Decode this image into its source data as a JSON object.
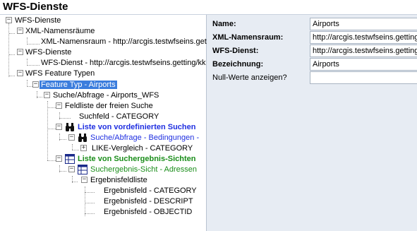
{
  "title": "WFS-Dienste",
  "tree": {
    "root": "WFS-Dienste",
    "xml_namespaces": "XML-Namensräume",
    "xml_namespace_item": "XML-Namensraum - http://arcgis.testwfseins.get",
    "wfs_services": "WFS-Dienste",
    "wfs_service_item": "WFS-Dienst - http://arcgis.testwfseins.getting/kk",
    "feature_types": "WFS Feature Typen",
    "feature_type_airports": "Feature Typ - Airports",
    "search_query": "Suche/Abfrage - Airports_WFS",
    "free_search_fields": "Feldliste der freien Suche",
    "search_field": "Suchfeld - CATEGORY",
    "predefined_searches": "Liste von vordefinierten Suchen",
    "search_conditions": "Suche/Abfrage - Bedingungen -",
    "like_compare": "LIKE-Vergleich - CATEGORY",
    "result_views": "Liste von Suchergebnis-Sichten",
    "result_view_addresses": "Suchergebnis-Sicht - Adressen",
    "result_field_list": "Ergebnisfeldliste",
    "result_fields": [
      "Ergebnisfeld - CATEGORY",
      "Ergebnisfeld - DESCRIPT",
      "Ergebnisfeld - OBJECTID"
    ]
  },
  "props": {
    "name_label": "Name:",
    "name_value": "Airports",
    "xmlns_label": "XML-Namensraum:",
    "xmlns_value": "http://arcgis.testwfseins.getting.",
    "wfs_label": "WFS-Dienst:",
    "wfs_value": "http://arcgis.testwfseins.getting/",
    "desc_label": "Bezeichnung:",
    "desc_value": "Airports",
    "null_label": "Null-Werte anzeigen?",
    "null_value": ""
  },
  "colors": {
    "selected_bg": "#3b7ddd",
    "blue_text": "#1f2fe0",
    "green_text": "#1a8d1a"
  }
}
